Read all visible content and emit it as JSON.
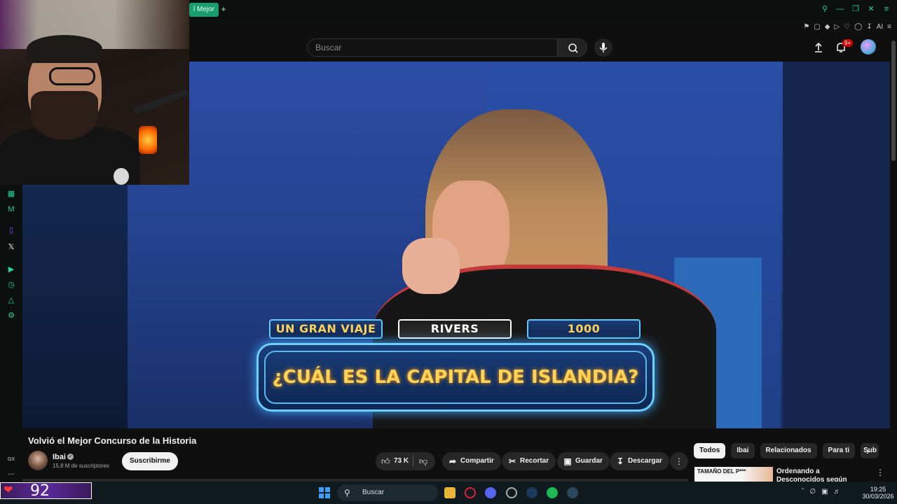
{
  "browser": {
    "active_tab_label": "l Mejor",
    "new_tab_label": "+",
    "window_controls": [
      "search-icon",
      "minimize-icon",
      "restore-icon",
      "close-icon",
      "menu-icon"
    ],
    "extension_labels": [
      "AI"
    ]
  },
  "opera_sidebar": {
    "items": [
      "workspace-icon",
      "messenger-icon",
      "twitch-icon",
      "x-icon",
      "player-icon",
      "history-icon",
      "extensions-icon",
      "settings-icon"
    ],
    "bottom_label": "GX",
    "more_label": "..."
  },
  "youtube_header": {
    "search_placeholder": "Buscar",
    "notifications_badge": "9+"
  },
  "video_overlay": {
    "chip_left": "UN GRAN VIAJE",
    "chip_middle": "RIVERS",
    "chip_right": "1000",
    "question": "¿CUÁL ES LA CAPITAL DE ISLANDIA?"
  },
  "video_info": {
    "title": "Volvió el Mejor Concurso de la Historia",
    "channel_name": "Ibai",
    "channel_subs": "15,8 M de suscriptores",
    "subscribe_label": "Suscribirme",
    "likes": "73 K",
    "share_label": "Compartir",
    "clip_label": "Recortar",
    "save_label": "Guardar",
    "download_label": "Descargar",
    "more_label": "⋮"
  },
  "right_sidebar": {
    "filter_chips": [
      "Todos",
      "Ibai",
      "Relacionados",
      "Para ti",
      "Sub"
    ],
    "rec_thumb_text": "TAMAÑO DEL P***",
    "rec_title": "Ordenando a Desconocidos según"
  },
  "taskbar": {
    "hp_value": "92",
    "search_label": "Buscar",
    "time": "19:25",
    "date": "30/03/2026"
  },
  "colors": {
    "accent": "#27d49a",
    "yt_bg": "#0f0f0f",
    "quiz_gold": "#ffd25a"
  }
}
